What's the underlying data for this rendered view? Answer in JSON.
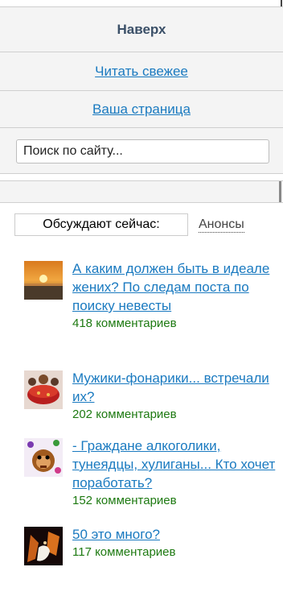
{
  "nav": {
    "top_label": "Наверх",
    "fresh_label": "Читать свежее",
    "page_label": "Ваша страница"
  },
  "search": {
    "placeholder": "Поиск по сайту..."
  },
  "tabs": {
    "active": "Обсуждают сейчас:",
    "other": "Анонсы"
  },
  "discussions": [
    {
      "title": "А каким должен быть в идеале жених? По следам поста по поиску невесты",
      "count": "418 комментариев"
    },
    {
      "title": "Мужики-фонарики... встречали их?",
      "count": "202 комментариев"
    },
    {
      "title": "- Граждане алкоголики, тунеядцы, хулиганы... Кто хочет поработать?",
      "count": "152 комментариев"
    },
    {
      "title": "50 это много?",
      "count": "117 комментариев"
    }
  ],
  "colors": {
    "link": "#1a7ac0",
    "count": "#1e7a12",
    "top_label": "#3b5068",
    "row_bg": "#f4f4f4"
  }
}
